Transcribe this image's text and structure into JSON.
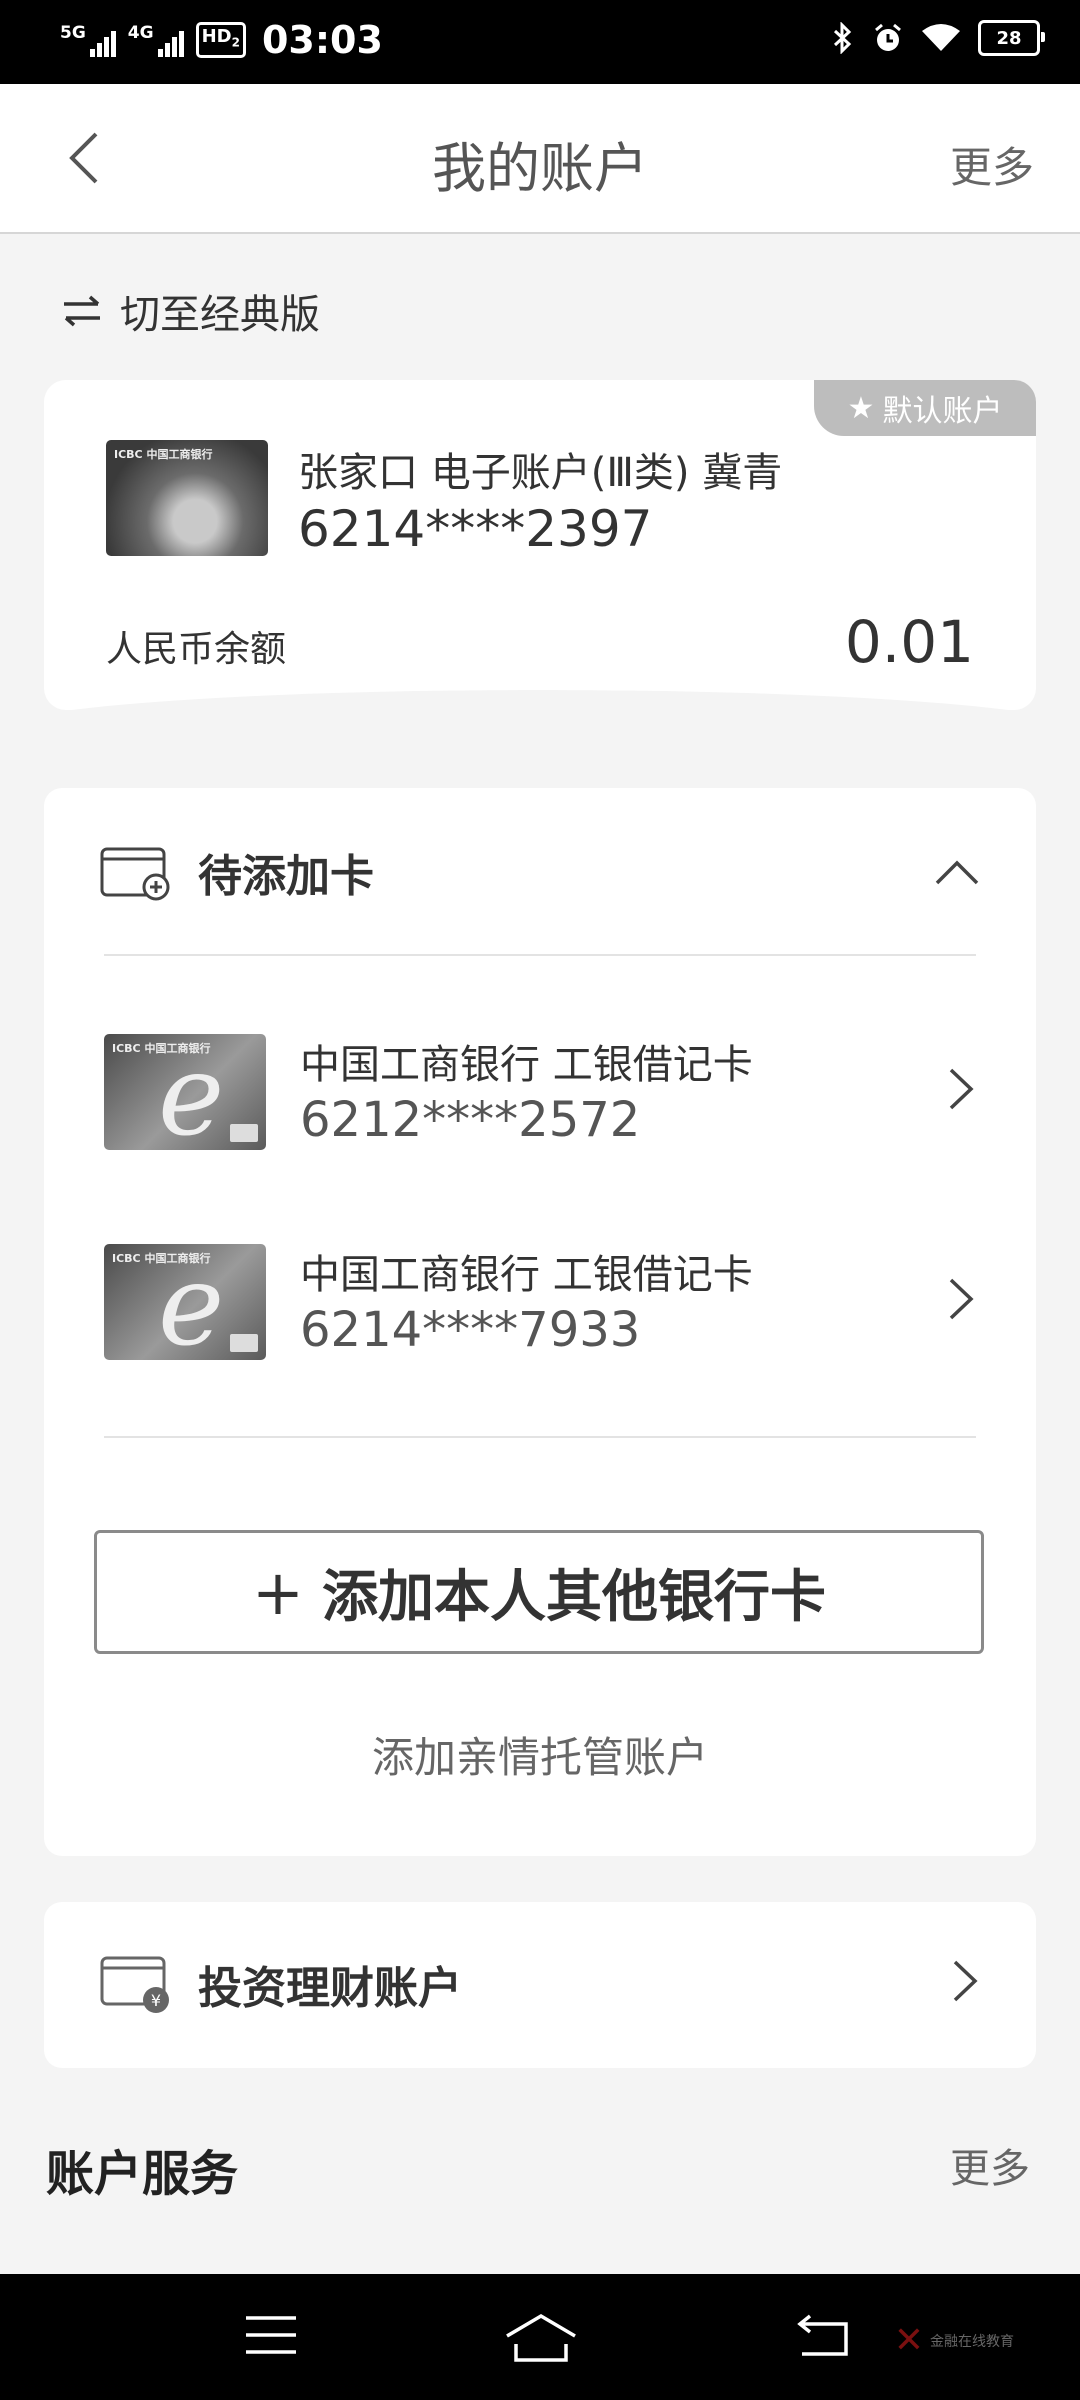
{
  "status_bar": {
    "signal1_label": "5G",
    "signal2_label": "4G",
    "hd_label": "HD",
    "hd_sub": "2",
    "time": "03:03",
    "battery": "28"
  },
  "header": {
    "title": "我的账户",
    "more": "更多"
  },
  "switch_label": "切至经典版",
  "main_account": {
    "badge": "默认账户",
    "name": "张家口  电子账户(Ⅲ类)  冀青",
    "number": "6214****2397",
    "balance_label": "人民币余额",
    "balance": "0.01",
    "card_text": "ICBC 中国工商银行"
  },
  "pending": {
    "title": "待添加卡",
    "cards": [
      {
        "name": "中国工商银行  工银借记卡",
        "number": "6212****2572",
        "card_text": "ICBC 中国工商银行"
      },
      {
        "name": "中国工商银行  工银借记卡",
        "number": "6214****7933",
        "card_text": "ICBC 中国工商银行"
      }
    ],
    "add_button": "添加本人其他银行卡",
    "family_link": "添加亲情托管账户"
  },
  "invest": {
    "title": "投资理财账户"
  },
  "services": {
    "title": "账户服务",
    "more": "更多"
  },
  "watermark": "金融在线教育",
  "colors": {
    "background": "#f4f4f4",
    "card": "#ffffff",
    "badge": "#bdbdbd",
    "text": "#333333"
  }
}
